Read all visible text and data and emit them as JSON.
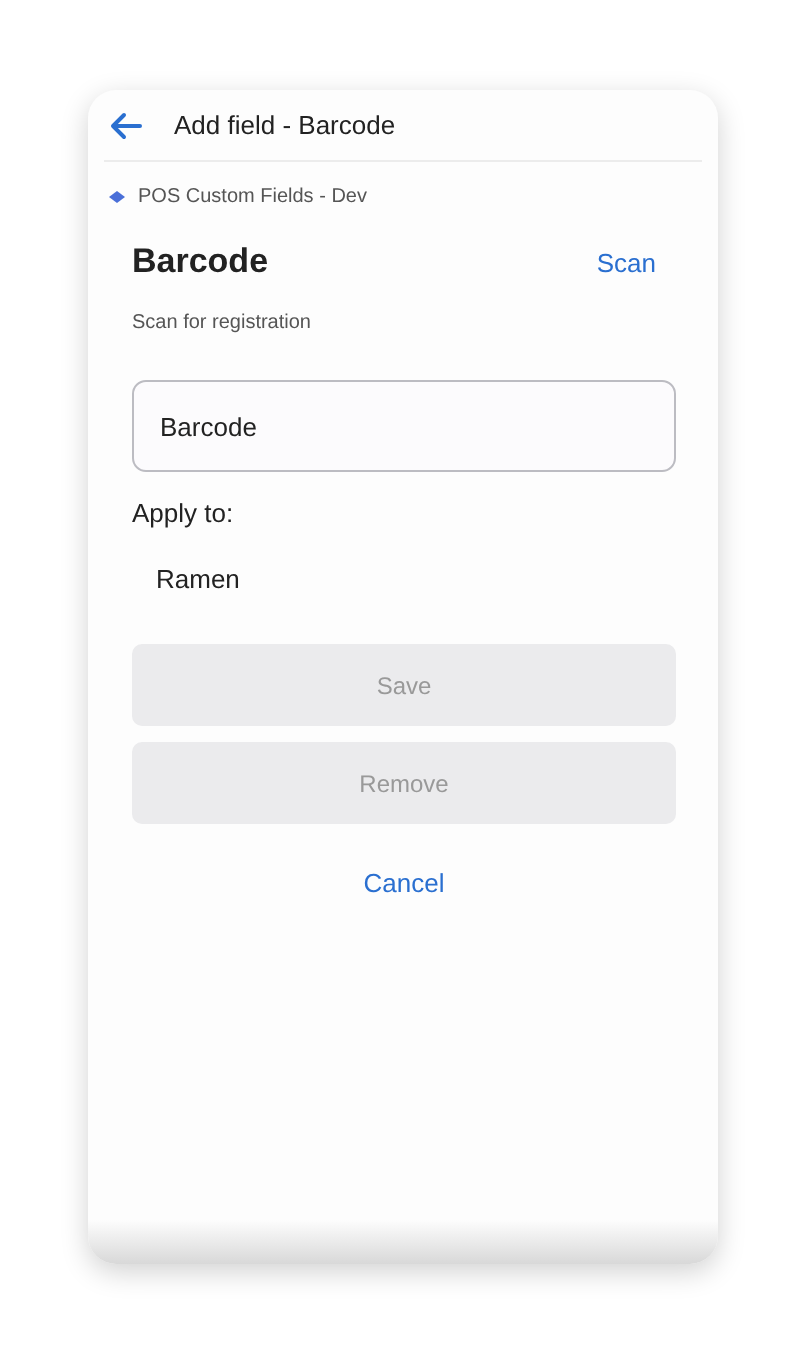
{
  "header": {
    "title": "Add field - Barcode"
  },
  "app": {
    "name": "POS Custom Fields - Dev"
  },
  "field": {
    "title": "Barcode",
    "action": "Scan",
    "description": "Scan for registration",
    "value": "Barcode"
  },
  "apply_to": {
    "label": "Apply to:",
    "items": [
      "Ramen"
    ]
  },
  "buttons": [
    {
      "label": "Save",
      "kind": "filled",
      "disabled": true
    },
    {
      "label": "Remove",
      "kind": "filled",
      "disabled": true
    },
    {
      "label": "Cancel",
      "kind": "plain",
      "disabled": false
    }
  ]
}
